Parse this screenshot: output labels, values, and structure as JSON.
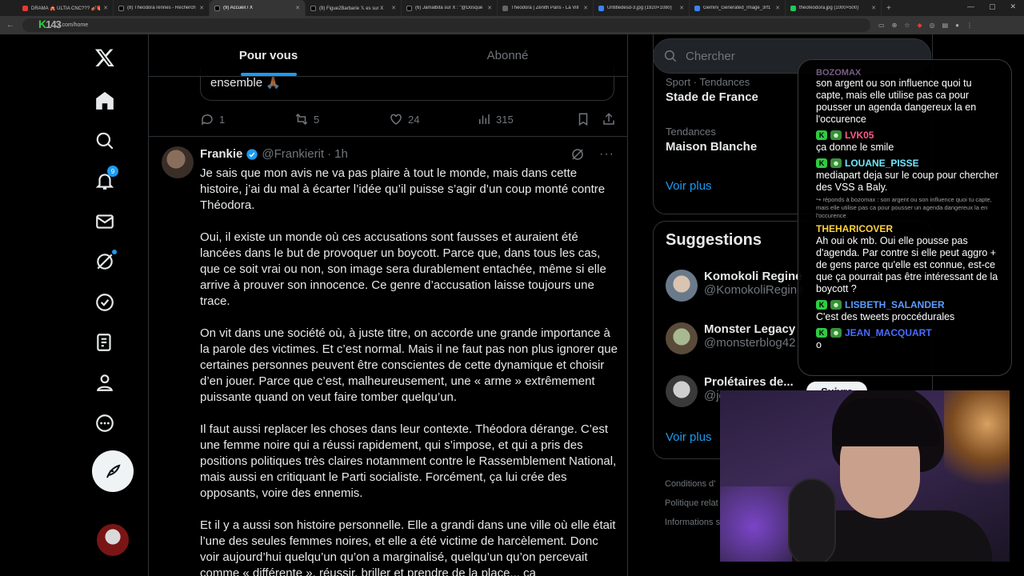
{
  "browser": {
    "tabs": [
      {
        "title": "DRAMA 🎪 ULTIA CNC??? 🎻🎁🎈",
        "fav": "red",
        "active": false
      },
      {
        "title": "(8) Theodora rennes - Recherch",
        "fav": "x",
        "active": false
      },
      {
        "title": "(9) Accueil / X",
        "fav": "x",
        "active": true
      },
      {
        "title": "(8) Figue2Barbarie 𝕏 es sur X",
        "fav": "x",
        "active": false
      },
      {
        "title": "(6) Jamalbita sur X : \"@Dosque",
        "fav": "x",
        "active": false
      },
      {
        "title": "Theodora | Zénith Paris - La Vill",
        "fav": "grey",
        "active": false
      },
      {
        "title": "Untitledesd-3.jpg (1920×1080)",
        "fav": "blue",
        "active": false
      },
      {
        "title": "Gemini_Generated_Image_3rf1",
        "fav": "blue",
        "active": false
      },
      {
        "title": "theofeodora.jpg (1000×500)",
        "fav": "green",
        "active": false
      }
    ],
    "url": "x.com/home",
    "watermark": "143"
  },
  "nav": {
    "notifications_badge": "9"
  },
  "feed": {
    "tabs": [
      "Pour vous",
      "Abonné"
    ],
    "quote_tail": "ensemble 🙏🏾",
    "prev_actions": {
      "replies": "1",
      "reposts": "5",
      "likes": "24",
      "views": "315"
    }
  },
  "tweet": {
    "name": "Frankie",
    "handle": "@Frankierit",
    "time": "1h",
    "paragraphs": [
      "Je sais que mon avis ne va pas plaire à tout le monde, mais dans cette histoire, j’ai du mal à écarter l’idée qu’il puisse s’agir d’un coup monté contre Théodora.",
      "Oui, il existe un monde où ces accusations sont fausses et auraient été lancées dans le but de provoquer un boycott. Parce que, dans tous les cas, que ce soit vrai ou non, son image sera durablement entachée, même si elle arrive à prouver son innocence. Ce genre d’accusation laisse toujours une trace.",
      "On vit dans une société où, à juste titre, on accorde une grande importance à la parole des victimes. Et c’est normal. Mais il ne faut pas non plus ignorer que certaines personnes peuvent être conscientes de cette dynamique et choisir d’en jouer. Parce que c’est, malheureusement, une « arme » extrêmement puissante quand on veut faire tomber quelqu’un.",
      "Il faut aussi replacer les choses dans leur contexte. Théodora dérange. C’est une femme noire qui a réussi rapidement, qui s’impose, et qui a pris des positions politiques très claires notamment contre le Rassemblement National, mais aussi en critiquant le Parti socialiste. Forcément, ça lui crée des opposants, voire des ennemis.",
      "Et il y a aussi son histoire personnelle. Elle a grandi dans une ville où elle était l’une des seules femmes noires, et elle a été victime de harcèlement. Donc voir aujourd’hui quelqu’un qu’on a marginalisé, quelqu’un qu’on percevait comme « différente », réussir, briller et prendre de la place... ça"
    ]
  },
  "sidebar": {
    "search_placeholder": "Chercher",
    "trends": [
      {
        "meta": "Sport · Tendances",
        "title": "Stade de France"
      },
      {
        "meta": "Tendances",
        "title": "Maison Blanche"
      }
    ],
    "voir_plus": "Voir plus",
    "suggestions_title": "Suggestions",
    "suggestions": [
      {
        "name": "Komokoli Regine",
        "handle": "@KomokoliRegine"
      },
      {
        "name": "Monster Legacy",
        "handle": "@monsterblog42"
      },
      {
        "name": "Prolétaires de...",
        "handle": "@je"
      }
    ],
    "follow_label": "Suivre",
    "voir_plus_2": "Voir plus",
    "footer": [
      "Conditions d’",
      "Politique relat",
      "Informations s"
    ]
  },
  "chat": {
    "top_user": "BOZOMAX",
    "messages": [
      {
        "user": "",
        "color": "",
        "text": "son argent ou son influence quoi tu capte, mais elle utilise pas ca pour pousser un agenda dangereux la en l'occurence"
      },
      {
        "user": "LVK05",
        "color": "#ff5b8a",
        "badges": true,
        "text": "ça donne le smile"
      },
      {
        "user": "LOUANE_PISSE",
        "color": "#6de8ff",
        "badges": true,
        "text": "mediapart deja sur le coup pour chercher des VSS a Baly."
      },
      {
        "reply": "↪ réponds à bozomax : son argent ou son influence quoi tu capte, mais elle utilise pas ca pour pousser un agenda dangereux la en l'occurence",
        "user": "THEHARICOVER",
        "color": "#ffd23f",
        "badges": false,
        "text": "Ah oui ok mb. Oui elle pousse pas d'agenda. Par contre si elle peut aggro + de gens parce qu'elle est connue, est-ce que ça pourrait pas être intéressant de la boycott ?"
      },
      {
        "user": "LISBETH_SALANDER",
        "color": "#5b9dff",
        "badges": true,
        "text": "C'est des tweets proccédurales"
      },
      {
        "user": "JEAN_MACQUART",
        "color": "#4a6cff",
        "badges": true,
        "text": "o"
      }
    ]
  },
  "colors": {
    "accent": "#1d9bf0",
    "bg": "#000000",
    "border": "#2f3336",
    "muted": "#71767b"
  }
}
